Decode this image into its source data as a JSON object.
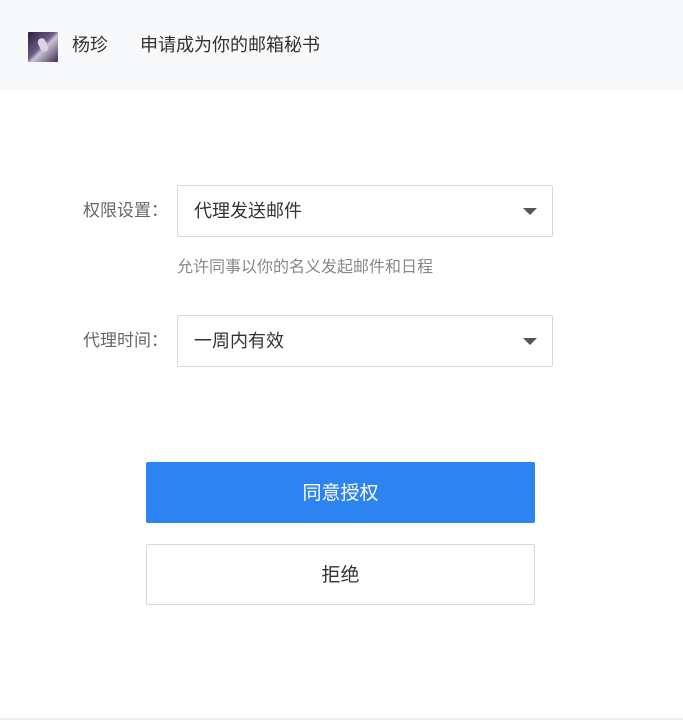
{
  "header": {
    "sender_name": "杨珍",
    "request_text": "申请成为你的邮箱秘书"
  },
  "form": {
    "permission": {
      "label": "权限设置：",
      "selected": "代理发送邮件",
      "hint": "允许同事以你的名义发起邮件和日程"
    },
    "duration": {
      "label": "代理时间：",
      "selected": "一周内有效"
    }
  },
  "actions": {
    "approve_label": "同意授权",
    "reject_label": "拒绝"
  },
  "colors": {
    "primary": "#2d84f0",
    "header_bg": "#f7f8fa"
  }
}
